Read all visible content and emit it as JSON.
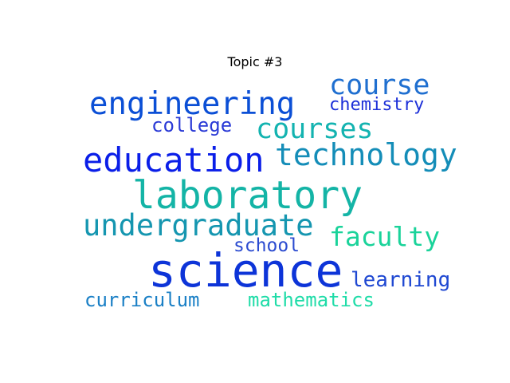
{
  "title": "Topic #3",
  "words": [
    {
      "id": "engineering",
      "text": "engineering",
      "color": "#0b4fd6"
    },
    {
      "id": "course",
      "text": "course",
      "color": "#1f6fd0"
    },
    {
      "id": "chemistry",
      "text": "chemistry",
      "color": "#1c2fd8"
    },
    {
      "id": "college",
      "text": "college",
      "color": "#2a3ad6"
    },
    {
      "id": "courses",
      "text": "courses",
      "color": "#13b3b0"
    },
    {
      "id": "education",
      "text": "education",
      "color": "#0a1ee8"
    },
    {
      "id": "technology",
      "text": "technology",
      "color": "#148db8"
    },
    {
      "id": "laboratory",
      "text": "laboratory",
      "color": "#14b4a6"
    },
    {
      "id": "undergraduate",
      "text": "undergraduate",
      "color": "#1596b0"
    },
    {
      "id": "faculty",
      "text": "faculty",
      "color": "#1ad39a"
    },
    {
      "id": "school",
      "text": "school",
      "color": "#2b4bd0"
    },
    {
      "id": "science",
      "text": "science",
      "color": "#0d34d8"
    },
    {
      "id": "learning",
      "text": "learning",
      "color": "#1f48d2"
    },
    {
      "id": "curriculum",
      "text": "curriculum",
      "color": "#1b80c6"
    },
    {
      "id": "mathematics",
      "text": "mathematics",
      "color": "#1fdca8"
    }
  ]
}
